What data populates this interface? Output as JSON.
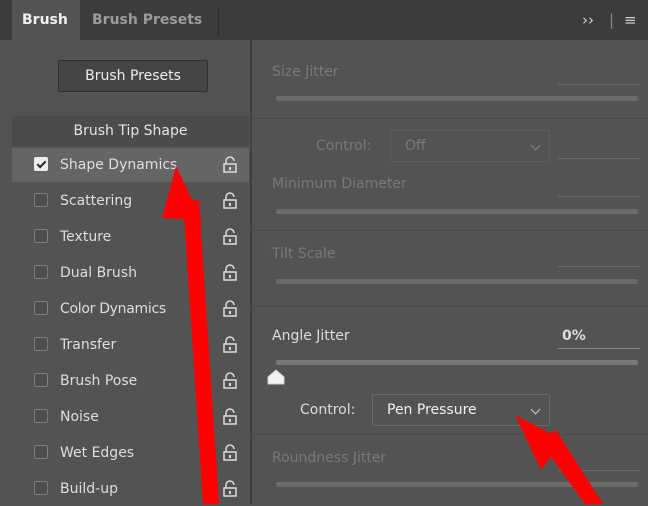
{
  "tabs": [
    {
      "label": "Brush",
      "active": true
    },
    {
      "label": "Brush Presets",
      "active": false
    }
  ],
  "panel_controls": {
    "expand": "›› ",
    "divider": "|",
    "menu": "≡"
  },
  "left": {
    "presets_button": "Brush Presets",
    "tip_header": "Brush Tip Shape",
    "items": [
      {
        "label": "Shape Dynamics",
        "checked": true,
        "selected": true
      },
      {
        "label": "Scattering",
        "checked": false
      },
      {
        "label": "Texture",
        "checked": false
      },
      {
        "label": "Dual Brush",
        "checked": false
      },
      {
        "label": "Color Dynamics",
        "checked": false
      },
      {
        "label": "Transfer",
        "checked": false
      },
      {
        "label": "Brush Pose",
        "checked": false
      },
      {
        "label": "Noise",
        "checked": false
      },
      {
        "label": "Wet Edges",
        "checked": false
      },
      {
        "label": "Build-up",
        "checked": false
      }
    ]
  },
  "right": {
    "size_jitter": "Size Jitter",
    "control_label_1": "Control:",
    "control_value_1": "Off",
    "minimum_diameter": "Minimum Diameter",
    "tilt_scale": "Tilt Scale",
    "angle_jitter": "Angle Jitter",
    "angle_jitter_value": "0%",
    "angle_jitter_level": 0,
    "control_label_2": "Control:",
    "control_value_2": "Pen Pressure",
    "roundness_jitter": "Roundness Jitter"
  },
  "colors": {
    "annotation_arrow": "#ff0000",
    "panel_bg": "#535353",
    "tab_bar": "#3c3c3c"
  }
}
